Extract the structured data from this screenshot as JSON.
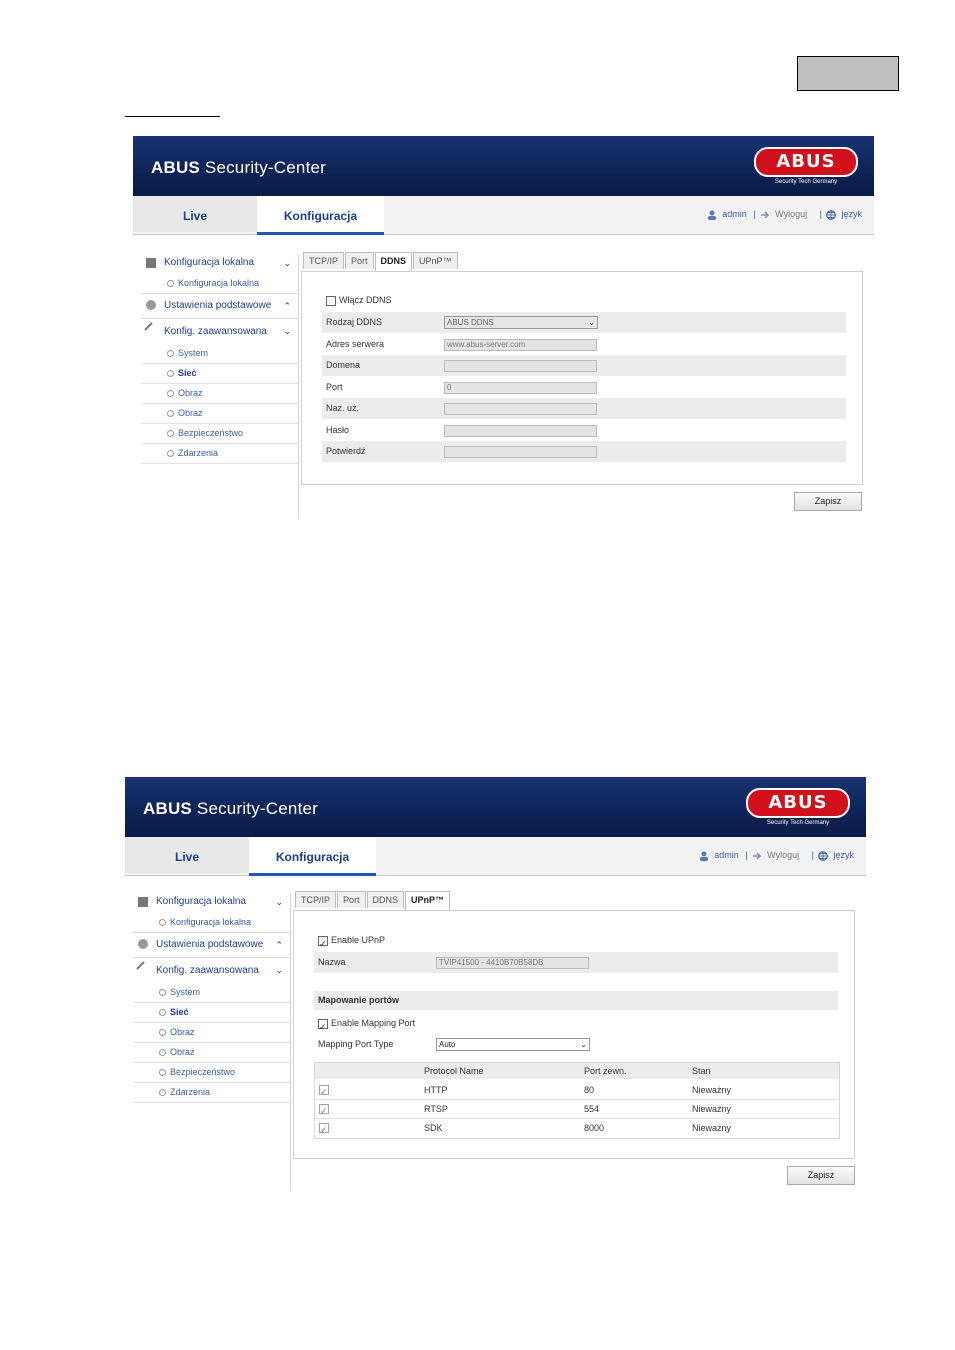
{
  "app": {
    "title_bold": "ABUS",
    "title_rest": " Security-Center",
    "logo_text": "ABUS",
    "logo_sub": "Security Tech Germany"
  },
  "nav": {
    "live": "Live",
    "konfig": "Konfiguracja",
    "user": "admin",
    "logout": "Wyloguj",
    "language": "język",
    "sep": "|"
  },
  "sidebar": {
    "local_head": "Konfiguracja lokalna",
    "local_items": [
      "Konfiguracja lokalna"
    ],
    "basic_head": "Ustawienia podstawowe",
    "adv_head": "Konfig. zaawansowana",
    "adv_items": [
      "System",
      "Sieć",
      "Obraz",
      "Obraz",
      "Bezpieczeństwo",
      "Zdarzenia"
    ]
  },
  "tabs": [
    "TCP/IP",
    "Port",
    "DDNS",
    "UPnP™"
  ],
  "ddns": {
    "enable": "Włącz DDNS",
    "type_label": "Rodzaj DDNS",
    "type_value": "ABUS DDNS",
    "server_label": "Adres serwera",
    "server_value": "www.abus-server.com",
    "domain_label": "Domena",
    "domain_value": "",
    "port_label": "Port",
    "port_value": "0",
    "user_label": "Naz. uż.",
    "user_value": "",
    "pass_label": "Hasło",
    "pass_value": "",
    "confirm_label": "Potwierdź",
    "confirm_value": ""
  },
  "upnp": {
    "enable": "Enable UPnP",
    "name_label": "Nazwa",
    "name_value": "TVIP41500 - 4410B70B58DB",
    "mapping_head": "Mapowanie portów",
    "enable_mapping": "Enable Mapping Port",
    "mapping_type_label": "Mapping Port Type",
    "mapping_type_value": "Auto",
    "columns": [
      "Protocol Name",
      "Port zewn.",
      "Stan"
    ],
    "rows": [
      {
        "protocol": "HTTP",
        "port": "80",
        "status": "Nieważny"
      },
      {
        "protocol": "RTSP",
        "port": "554",
        "status": "Nieważny"
      },
      {
        "protocol": "SDK",
        "port": "8000",
        "status": "Nieważny"
      }
    ]
  },
  "save": "Zapisz"
}
